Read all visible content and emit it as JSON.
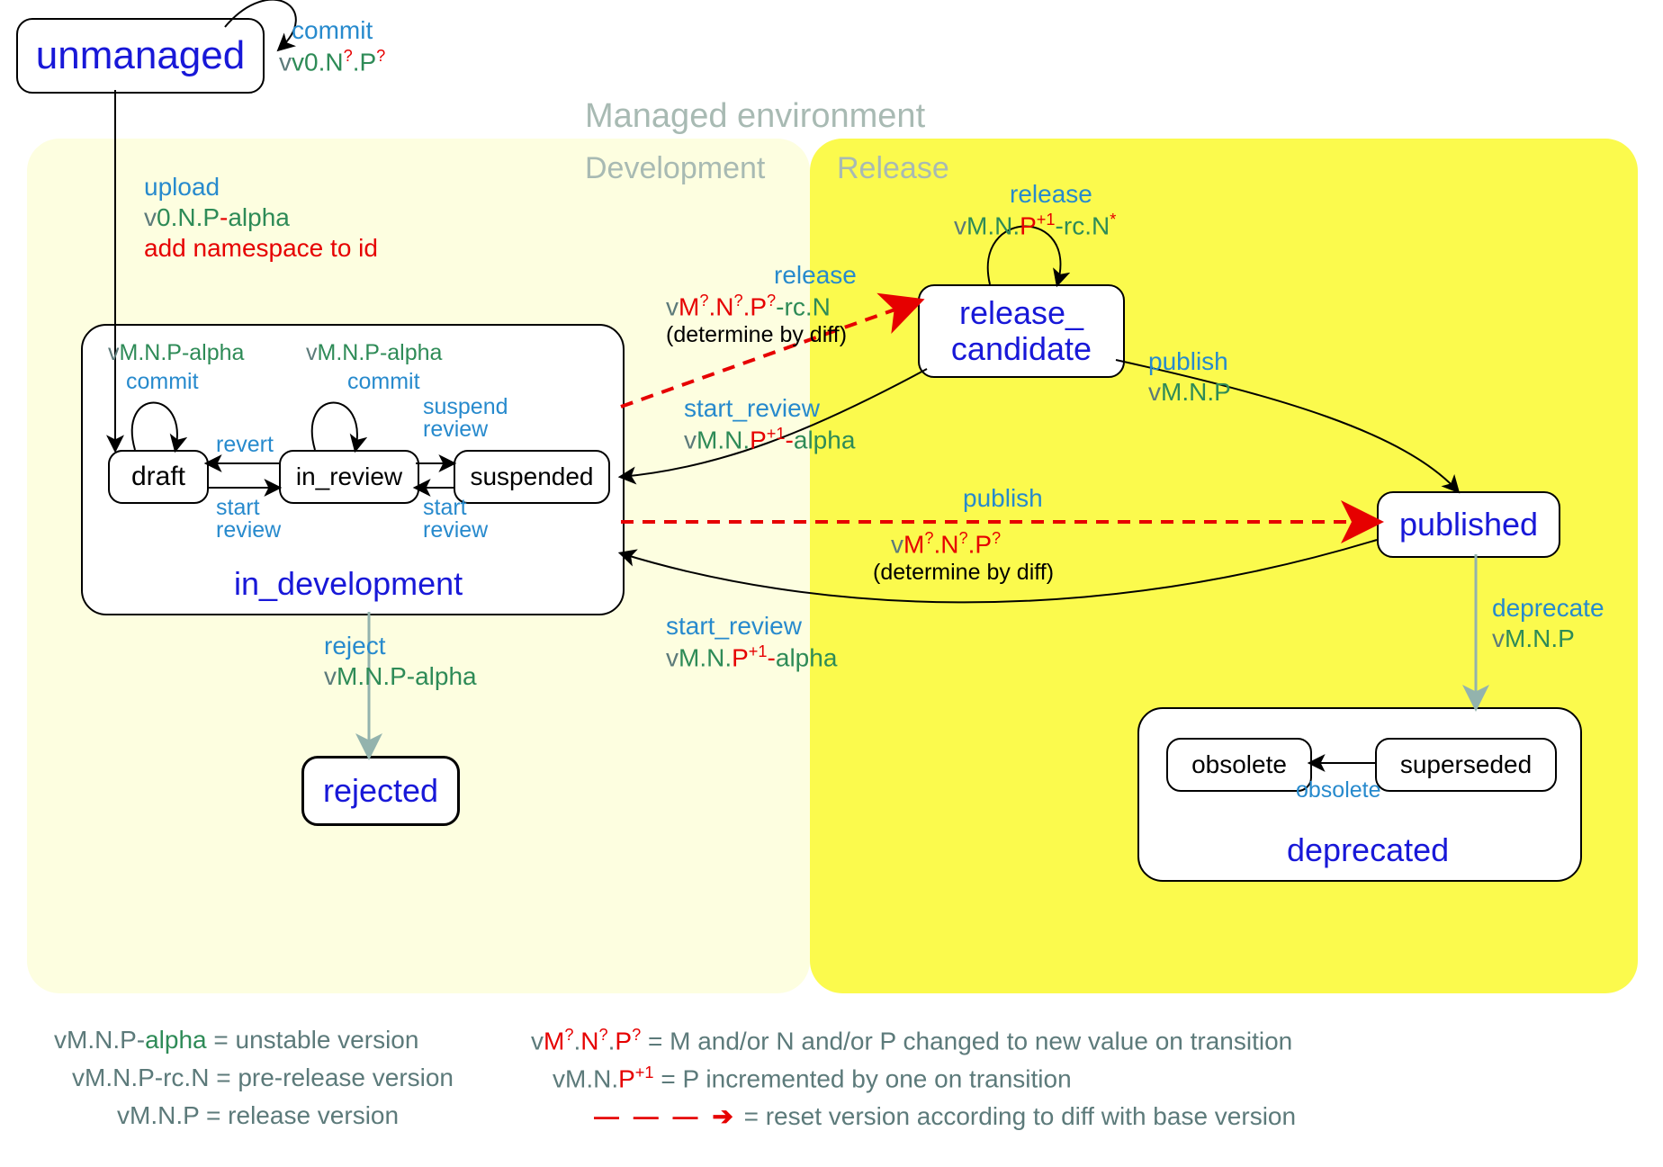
{
  "title": "Managed environment",
  "sections": {
    "development": "Development",
    "release": "Release"
  },
  "states": {
    "unmanaged": "unmanaged",
    "in_development": "in_development",
    "draft": "draft",
    "in_review": "in_review",
    "suspended": "suspended",
    "rejected": "rejected",
    "release_candidate_l1": "release_",
    "release_candidate_l2": "candidate",
    "published": "published",
    "deprecated": "deprecated",
    "obsolete": "obsolete",
    "superseded": "superseded"
  },
  "transitions": {
    "unmanaged_commit": {
      "label": "commit",
      "version_prefix": "v0.N",
      "q1": "?",
      "mid": ".P",
      "q2": "?"
    },
    "upload": {
      "label": "upload",
      "version": "v0.N.P-",
      "suffix": "alpha",
      "note": "add namespace to id"
    },
    "draft_commit": {
      "label": "commit",
      "vprefix": "v",
      "vgreen": "M.N.P-",
      "vsuffix": "alpha"
    },
    "review_commit": {
      "label": "commit",
      "vprefix": "v",
      "vgreen": "M.N.P-",
      "vsuffix": "alpha"
    },
    "revert": "revert",
    "start_review": "start\nreview",
    "suspend_review": "suspend\nreview",
    "reject": {
      "label": "reject",
      "vprefix": "v",
      "vgreen": "M.N.P-",
      "vsuffix": "alpha"
    },
    "release_to_rc": {
      "label": "release",
      "vprefix": "v",
      "m": "M",
      "q1": "?",
      "d1": ".",
      "n": "N",
      "q2": "?",
      "d2": ".",
      "p": "P",
      "q3": "?",
      "rc": "-rc.N",
      "note": "(determine by diff)"
    },
    "rc_release_self": {
      "label": "release",
      "vprefix": "v",
      "vgreen": "M.N.P",
      "plus": "+1",
      "rc": "-rc.N",
      "star": "*"
    },
    "rc_start_review": {
      "label": "start_review",
      "vprefix": "v",
      "vgreen1": "M.N.",
      "p": "P",
      "plus": "+1",
      "dash": "-",
      "vsuffix": "alpha"
    },
    "publish_diff": {
      "label": "publish",
      "vprefix": "v",
      "m": "M",
      "q1": "?",
      "d1": ".",
      "n": "N",
      "q2": "?",
      "d2": ".",
      "p": "P",
      "q3": "?",
      "note": "(determine by diff)"
    },
    "publish": {
      "label": "publish",
      "vprefix": "v",
      "vgreen": "M.N.P"
    },
    "pub_start_review": {
      "label": "start_review",
      "vprefix": "v",
      "vgreen1": "M.N.",
      "p": "P",
      "plus": "+1",
      "dash": "-",
      "vsuffix": "alpha"
    },
    "deprecate": {
      "label": "deprecate",
      "vprefix": "v",
      "vgreen": "M.N.P"
    },
    "obsolete_t": "obsolete"
  },
  "legend": {
    "l1_pre": "vM.N.P-",
    "l1_alpha": "alpha",
    "l1_desc": " = unstable version",
    "l2": "vM.N.P-rc.N = pre-release version",
    "l3": "vM.N.P = release version",
    "r1_pre": "v",
    "r1_m": "M",
    "r1_q": "?",
    "r1_d": ".",
    "r1_n": "N",
    "r1_p": "P",
    "r1_desc": " = M and/or N and/or P changed to new value on transition",
    "r2_pre": "v",
    "r2_body": "M.N.",
    "r2_p": "P",
    "r2_plus": "+1",
    "r2_desc": " = P incremented by one on transition",
    "r3_arrow": "– – – ➔",
    "r3_desc": " = reset version according to diff with base version"
  }
}
